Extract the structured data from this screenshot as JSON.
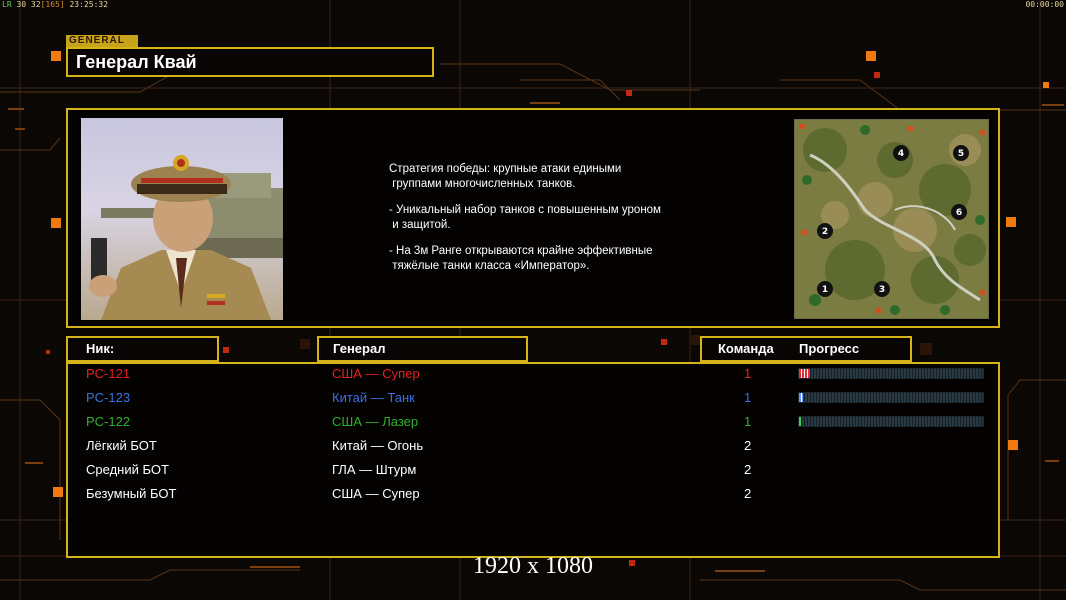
{
  "overlay": {
    "fps_label": "LR",
    "fps_values": "30 32",
    "fps_extra": "[165]",
    "clock": "23:25:32",
    "timer": "00:00:00",
    "resolution": "1920 x 1080"
  },
  "general": {
    "tag": "GENERAL",
    "name": "Генерал Квай",
    "description": [
      "Стратегия победы: крупные атаки едиными\n группами многочисленных танков.",
      "- Уникальный набор танков с повышенным уроном\n и защитой.",
      "- На 3м Ранге открываются крайне эффективные\n тяжёлые танки класса «Император»."
    ]
  },
  "map": {
    "start_positions": [
      "1",
      "2",
      "3",
      "4",
      "5",
      "6"
    ]
  },
  "table": {
    "headers": {
      "nick": "Ник:",
      "general": "Генерал",
      "team": "Команда",
      "progress": "Прогресс"
    },
    "players": [
      {
        "nick": "PC-121",
        "general": "США — Супер",
        "team": "1",
        "color": "#e52020",
        "progress": 0.06,
        "bar_color": "#e0343a"
      },
      {
        "nick": "PC-123",
        "general": "Китай — Танк",
        "team": "1",
        "color": "#3b6fe0",
        "progress": 0.02,
        "bar_color": "#6a92ff"
      },
      {
        "nick": "PC-122",
        "general": "США — Лазер",
        "team": "1",
        "color": "#2fb02f",
        "progress": 0.01,
        "bar_color": "#3fd04f"
      },
      {
        "nick": "Лёгкий БОТ",
        "general": "Китай — Огонь",
        "team": "2",
        "color": "#ffffff"
      },
      {
        "nick": "Средний БОТ",
        "general": "ГЛА — Штурм",
        "team": "2",
        "color": "#ffffff"
      },
      {
        "nick": "Безумный БОТ",
        "general": "США — Супер",
        "team": "2",
        "color": "#ffffff"
      }
    ]
  }
}
